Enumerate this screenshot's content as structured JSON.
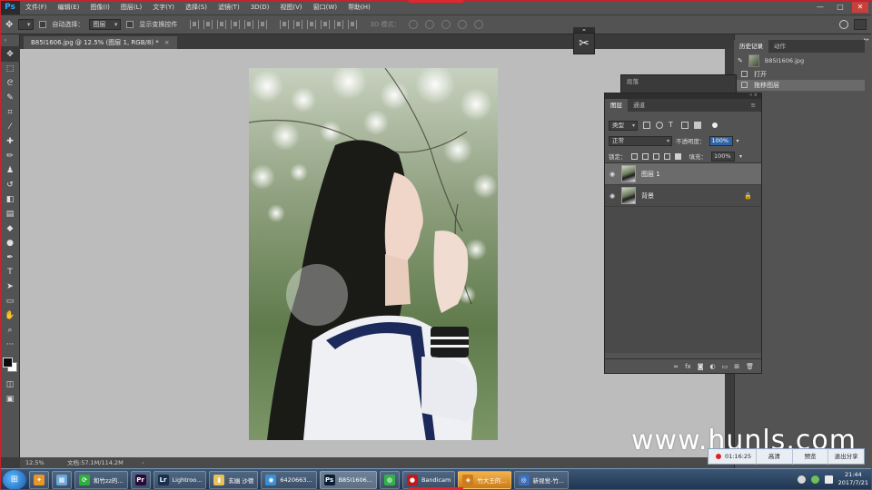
{
  "app": {
    "logo": "Ps",
    "menu": [
      "文件(F)",
      "编辑(E)",
      "图像(I)",
      "图层(L)",
      "文字(Y)",
      "选择(S)",
      "滤镜(T)",
      "3D(D)",
      "视图(V)",
      "窗口(W)",
      "帮助(H)"
    ],
    "window_controls": [
      "—",
      "□",
      "✕"
    ]
  },
  "options": {
    "auto_select_label": "自动选择：",
    "auto_select_value": "图层",
    "show_transform_label": "显示变换控件",
    "mode_3d_label": "3D 模式："
  },
  "document": {
    "tab_title": "B85I1606.jpg @ 12.5% (图层 1, RGB/8) *",
    "tab_close": "×",
    "zoom": "12.5%",
    "doc_size": "文档:57.1M/114.2M"
  },
  "history": {
    "tabs": [
      "历史记录",
      "动作"
    ],
    "snapshot_name": "B85I1606.jpg",
    "items": [
      "打开",
      "拖移图层"
    ]
  },
  "back_panel": {
    "tab": "段落"
  },
  "layers": {
    "tabs": [
      "图层",
      "通道"
    ],
    "filter_type": "类型",
    "blend_mode": "正常",
    "opacity_label": "不透明度：",
    "opacity_value": "100%",
    "lock_label": "锁定：",
    "fill_label": "填充：",
    "fill_value": "100%",
    "items": [
      {
        "name": "图层 1",
        "selected": true,
        "locked": false
      },
      {
        "name": "背景",
        "selected": false,
        "locked": true
      }
    ],
    "footer_icons": [
      "link-icon",
      "fx-icon",
      "mask-icon",
      "adjustment-icon",
      "folder-icon",
      "new-layer-icon",
      "trash-icon"
    ],
    "footer_labels": [
      "∞",
      "fx",
      "◙",
      "◐",
      "▭",
      "⊞",
      "🗑"
    ]
  },
  "watermark": "www.hunls.com",
  "recorder": {
    "time": "01:16:25",
    "buttons": [
      "高清",
      "预览",
      "退出分享"
    ]
  },
  "taskbar": {
    "items": [
      {
        "icon": "✦",
        "label": "",
        "color": "#e7962c"
      },
      {
        "icon": "▦",
        "label": "",
        "color": "#6ea8d8"
      },
      {
        "icon": "⟳",
        "label": "和竹zz的...",
        "color": "#2fae3c"
      },
      {
        "icon": "Pr",
        "label": "",
        "color": "#2a0a3a"
      },
      {
        "icon": "Lr",
        "label": "Lightroo...",
        "color": "#18314e"
      },
      {
        "icon": "▮",
        "label": "玄幽 沙德",
        "color": "#e8c15a"
      },
      {
        "icon": "◉",
        "label": "6420663...",
        "color": "#3a8fd6"
      },
      {
        "icon": "Ps",
        "label": "B85I1606...",
        "color": "#0a1e36"
      },
      {
        "icon": "◍",
        "label": "",
        "color": "#33b24a"
      },
      {
        "icon": "●",
        "label": "Bandicam",
        "color": "#c41818"
      },
      {
        "icon": "◈",
        "label": "竹大王的...",
        "color": "#d07a18"
      },
      {
        "icon": "◎",
        "label": "新视觉-竹...",
        "color": "#3b6fbf"
      }
    ],
    "time": "21:44",
    "date": "2017/7/21"
  }
}
